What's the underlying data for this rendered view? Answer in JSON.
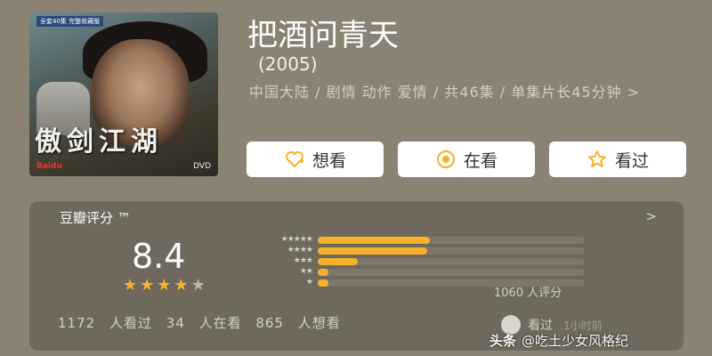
{
  "poster": {
    "badge": "全套40集 完整收藏版",
    "calligraphy": "傲剑江湖",
    "logo": "Baidu",
    "dvd": "DVD"
  },
  "movie": {
    "title": "把酒问青天",
    "year": "(2005)",
    "meta": "中国大陆 / 剧情 动作 爱情 / 共46集 / 单集片长45分钟 >"
  },
  "actions": [
    {
      "label": "想看",
      "icon": "heart-plus-icon"
    },
    {
      "label": "在看",
      "icon": "radio-dot-icon"
    },
    {
      "label": "看过",
      "icon": "star-outline-icon"
    }
  ],
  "rating": {
    "card_title": "豆瓣评分 ™",
    "score": "8.4",
    "stars_filled": 4,
    "stars_total": 5,
    "distribution": [
      {
        "stars": "★★★★★",
        "fraction": 0.42
      },
      {
        "stars": "★★★★",
        "fraction": 0.41
      },
      {
        "stars": "★★★",
        "fraction": 0.15
      },
      {
        "stars": "★★",
        "fraction": 0.04
      },
      {
        "stars": "★",
        "fraction": 0.04
      }
    ],
    "count_label": "1060 人评分",
    "stats": "1172 人看过   34 人在看   865 人想看",
    "seen_label": "看过",
    "seen_time": "1小时前"
  },
  "footer": {
    "brand": "头条",
    "author": "@吃土少女风格纪"
  },
  "colors": {
    "accent": "#f6b22b",
    "background": "#8a8273",
    "card": "#6f695d"
  }
}
